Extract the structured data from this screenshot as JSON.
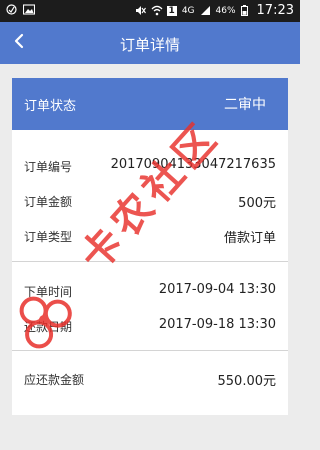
{
  "status_bar": {
    "network": "4G",
    "battery": "46%",
    "time": "17:23",
    "sim_badge": "1"
  },
  "header": {
    "title": "订单详情",
    "back_icon": "chevron-left-icon"
  },
  "order": {
    "status_label": "订单状态",
    "status_value": "二审中",
    "fields": [
      {
        "label": "订单编号",
        "value": "20170904133047217635"
      },
      {
        "label": "订单金额",
        "value": "500元"
      },
      {
        "label": "订单类型",
        "value": "借款订单"
      },
      {
        "label": "下单时间",
        "value": "2017-09-04 13:30"
      },
      {
        "label": "还款日期",
        "value": "2017-09-18 13:30"
      },
      {
        "label": "应还款金额",
        "value": "550.00元"
      }
    ]
  },
  "watermark": {
    "text": "卡农社区",
    "color": "#e8302b"
  },
  "colors": {
    "accent": "#5179cd",
    "status_bar": "#1c1c1c",
    "background": "#ececec"
  }
}
